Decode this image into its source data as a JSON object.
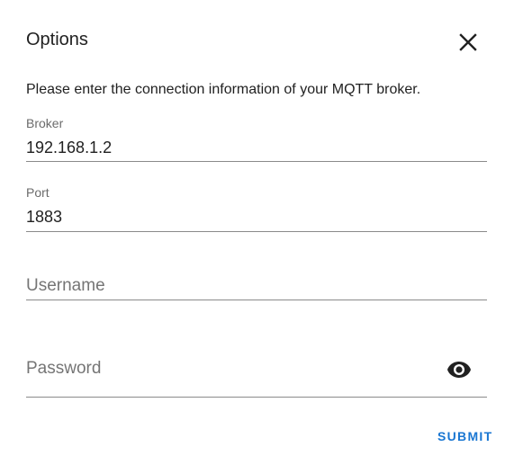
{
  "dialog": {
    "title": "Options",
    "description": "Please enter the connection information of your MQTT broker.",
    "close_icon": "close-icon"
  },
  "fields": {
    "broker": {
      "label": "Broker",
      "value": "192.168.1.2"
    },
    "port": {
      "label": "Port",
      "value": "1883"
    },
    "username": {
      "placeholder": "Username",
      "value": ""
    },
    "password": {
      "placeholder": "Password",
      "value": "",
      "toggle_icon": "eye-icon"
    }
  },
  "actions": {
    "submit_label": "SUBMIT"
  },
  "colors": {
    "accent": "#1976d2",
    "text": "#212121",
    "label": "#6b6b6b",
    "underline": "#8a8a8a"
  }
}
